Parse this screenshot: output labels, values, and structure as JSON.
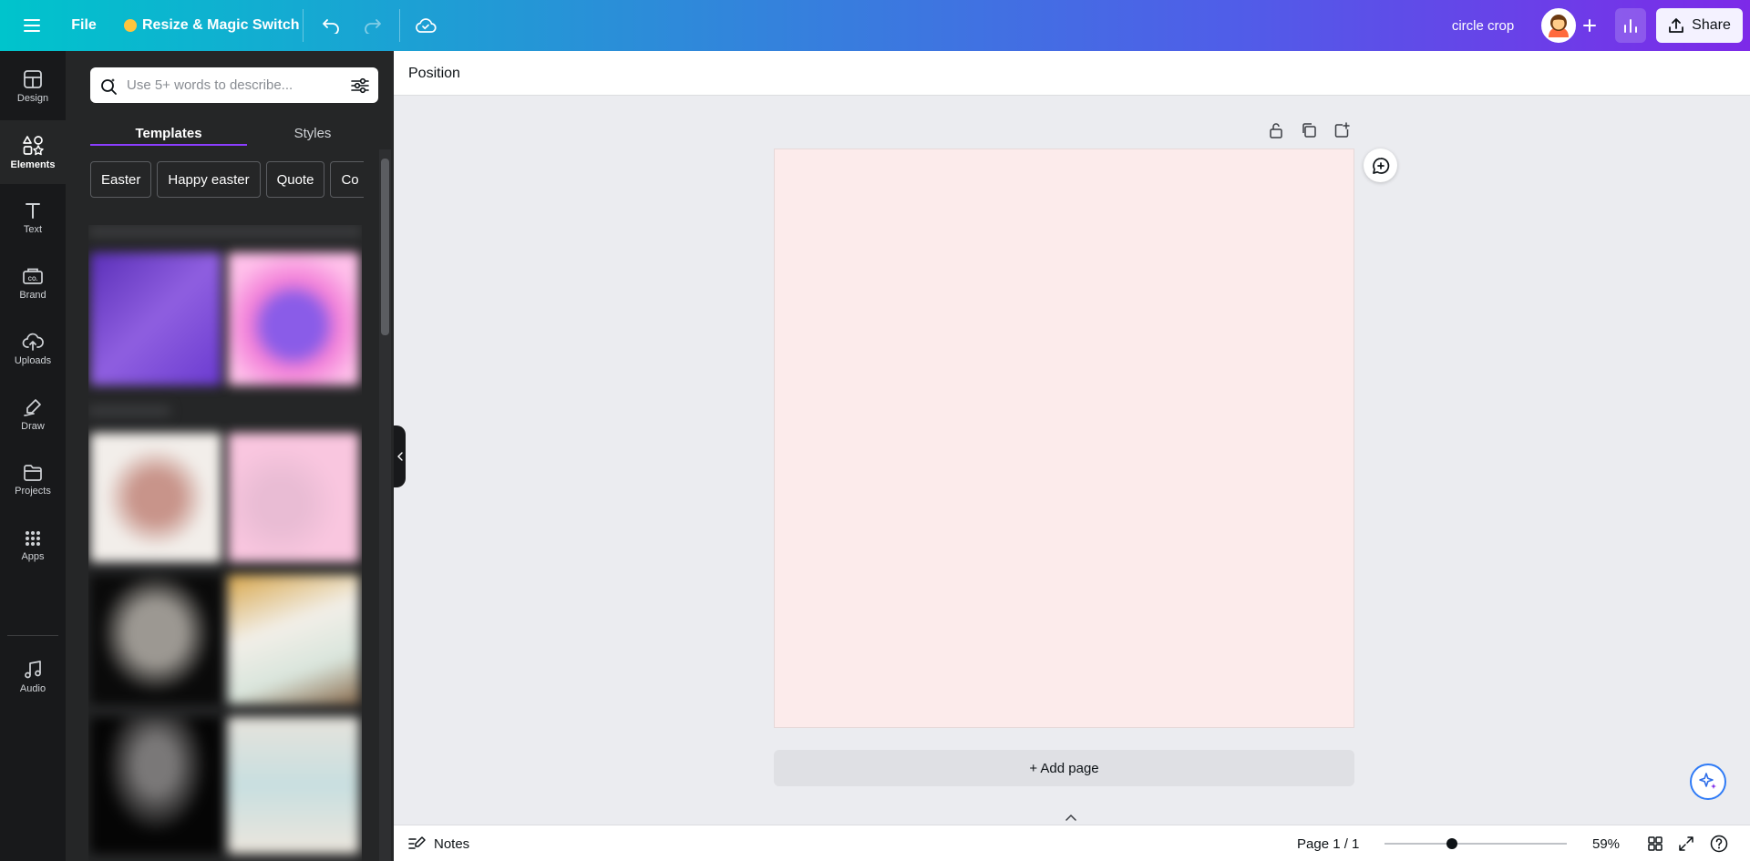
{
  "topbar": {
    "file_label": "File",
    "resize_label": "Resize & Magic Switch",
    "design_title": "circle crop",
    "share_label": "Share"
  },
  "rail": {
    "items": [
      {
        "label": "Design",
        "icon": "layout-icon"
      },
      {
        "label": "Elements",
        "icon": "shapes-icon"
      },
      {
        "label": "Text",
        "icon": "text-icon"
      },
      {
        "label": "Brand",
        "icon": "brand-icon"
      },
      {
        "label": "Uploads",
        "icon": "cloud-upload-icon"
      },
      {
        "label": "Draw",
        "icon": "draw-icon"
      },
      {
        "label": "Projects",
        "icon": "folder-icon"
      },
      {
        "label": "Apps",
        "icon": "apps-grid-icon"
      },
      {
        "label": "Audio",
        "icon": "music-note-icon"
      }
    ],
    "active": "Elements"
  },
  "panel": {
    "search_placeholder": "Use 5+ words to describe...",
    "tabs": [
      "Templates",
      "Styles"
    ],
    "active_tab": "Templates",
    "chips": [
      "Easter",
      "Happy easter",
      "Quote",
      "Co"
    ]
  },
  "toolbar": {
    "position_label": "Position"
  },
  "canvas": {
    "page_color": "#fcebeb",
    "add_page_label": "+ Add page"
  },
  "bottombar": {
    "notes_label": "Notes",
    "page_info": "Page 1 / 1",
    "zoom_label": "59%",
    "zoom_value": 59
  },
  "colors": {
    "accent": "#8b3dff",
    "rail_bg": "#18191b",
    "panel_bg": "#252627"
  }
}
